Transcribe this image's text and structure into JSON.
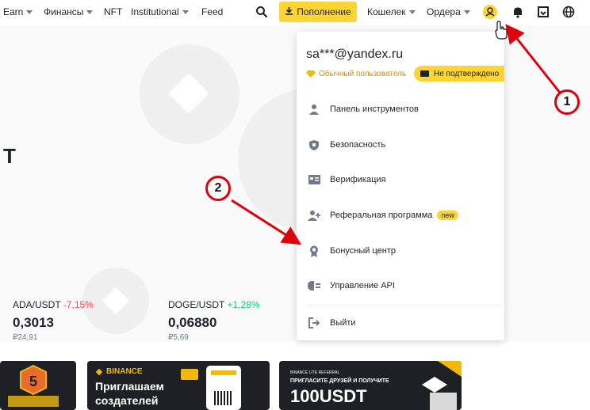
{
  "nav": {
    "earn": "Earn",
    "finance": "Финансы",
    "nft": "NFT",
    "institutional": "Institutional",
    "feed": "Feed",
    "deposit": "Пополнение",
    "wallet": "Кошелек",
    "orders": "Ордера"
  },
  "hero": {
    "partial_title": "T"
  },
  "tickers": [
    {
      "pair": "ADA/USDT",
      "change": "-7,15%",
      "price": "0,3013",
      "rub": "₽24,91"
    },
    {
      "pair": "DOGE/USDT",
      "change": "+1,28%",
      "price": "0,06880",
      "rub": "₽5,69"
    }
  ],
  "dropdown": {
    "email": "sa***@yandex.ru",
    "user_level": "Обычный пользователь",
    "status": "Не подтверждено",
    "items": [
      {
        "label": "Панель инструментов",
        "icon": "user-icon"
      },
      {
        "label": "Безопасность",
        "icon": "shield-icon"
      },
      {
        "label": "Верификация",
        "icon": "id-card-icon"
      },
      {
        "label": "Реферальная программа",
        "icon": "add-user-icon",
        "badge": "new"
      },
      {
        "label": "Бонусный центр",
        "icon": "medal-icon"
      },
      {
        "label": "Управление API",
        "icon": "api-icon"
      }
    ],
    "logout": "Выйти"
  },
  "annotations": [
    "1",
    "2"
  ],
  "banners": {
    "binance_logo": "BINANCE",
    "invite_title_1": "Приглашаем",
    "invite_title_2": "создателей",
    "referral_top": "BINANCE LITE REFERRAL",
    "referral_sub": "ПРИГЛАСИТЕ ДРУЗЕЙ И ПОЛУЧИТЕ",
    "referral_amount": "100USDT"
  },
  "colors": {
    "accent": "#fcd535",
    "negative": "#f6465d",
    "positive": "#0ecb81",
    "annotation": "#e0000b"
  }
}
